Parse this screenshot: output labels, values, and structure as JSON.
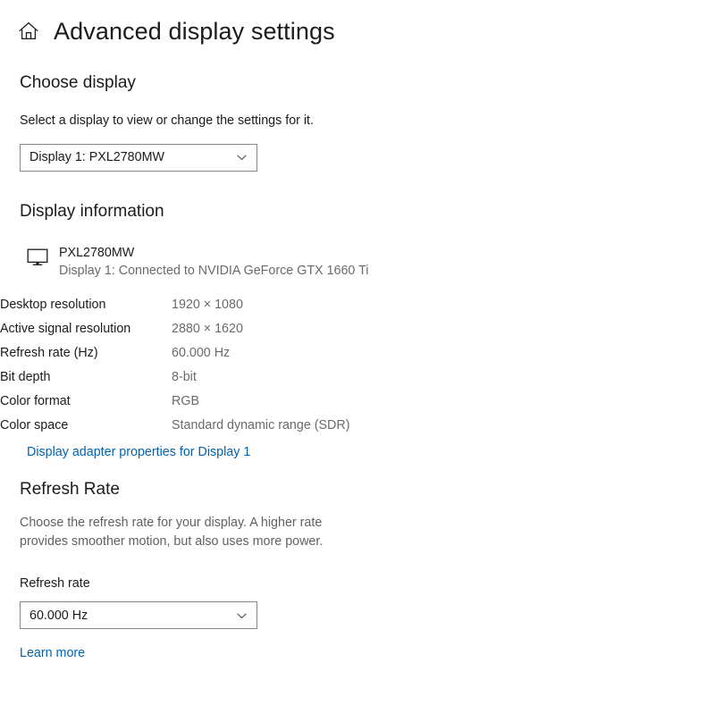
{
  "header": {
    "home_icon": "home-icon",
    "title": "Advanced display settings"
  },
  "choose_display": {
    "heading": "Choose display",
    "description": "Select a display to view or change the settings for it.",
    "dropdown": {
      "selected": "Display 1: PXL2780MW",
      "chevron_icon": "chevron-down-icon"
    }
  },
  "display_information": {
    "heading": "Display information",
    "device": {
      "monitor_icon": "monitor-icon",
      "name": "PXL2780MW",
      "connection": "Display 1: Connected to NVIDIA GeForce GTX 1660 Ti"
    },
    "specs": [
      {
        "label": "Desktop resolution",
        "value": "1920 × 1080"
      },
      {
        "label": "Active signal resolution",
        "value": "2880 × 1620"
      },
      {
        "label": "Refresh rate (Hz)",
        "value": "60.000 Hz"
      },
      {
        "label": "Bit depth",
        "value": "8-bit"
      },
      {
        "label": "Color format",
        "value": "RGB"
      },
      {
        "label": "Color space",
        "value": "Standard dynamic range (SDR)"
      }
    ],
    "adapter_link": "Display adapter properties for Display 1"
  },
  "refresh_rate": {
    "heading": "Refresh Rate",
    "description": "Choose the refresh rate for your display. A higher rate provides smoother motion, but also uses more power.",
    "field_label": "Refresh rate",
    "dropdown": {
      "selected": "60.000 Hz",
      "chevron_icon": "chevron-down-icon"
    },
    "learn_more": "Learn more"
  },
  "colors": {
    "link": "#0063b1",
    "text": "#1b1b1b",
    "muted": "#6a6a6a",
    "border": "#868686",
    "background": "#ffffff"
  }
}
